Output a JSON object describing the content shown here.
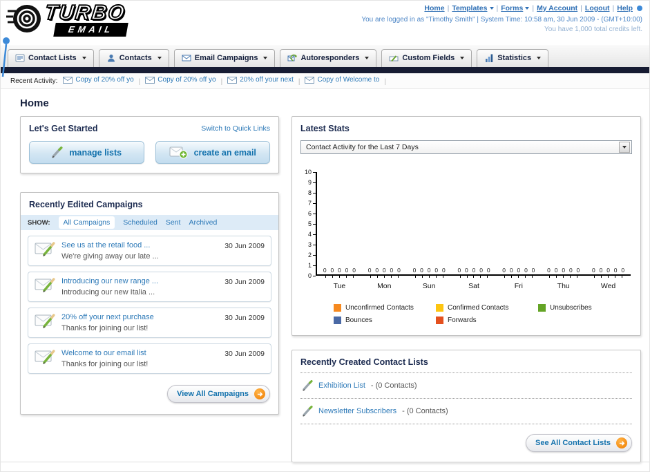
{
  "page": {
    "title": "Home"
  },
  "header": {
    "logo_primary": "TURBO",
    "logo_secondary": "EMAIL",
    "nav": [
      {
        "label": "Home",
        "dropdown": false
      },
      {
        "label": "Templates",
        "dropdown": true
      },
      {
        "label": "Forms",
        "dropdown": true
      },
      {
        "label": "My Account",
        "dropdown": false
      },
      {
        "label": "Logout",
        "dropdown": false
      },
      {
        "label": "Help",
        "dropdown": false
      }
    ],
    "login_info": "You are logged in as \"Timothy Smith\" | System Time: 10:58 am, 30 Jun 2009 - (GMT+10:00)",
    "credits_info": "You have 1,000 total credits left."
  },
  "main_tabs": [
    {
      "label": "Contact Lists",
      "icon": "contact-lists"
    },
    {
      "label": "Contacts",
      "icon": "contacts"
    },
    {
      "label": "Email Campaigns",
      "icon": "email-campaigns"
    },
    {
      "label": "Autoresponders",
      "icon": "autoresponders"
    },
    {
      "label": "Custom Fields",
      "icon": "custom-fields"
    },
    {
      "label": "Statistics",
      "icon": "statistics"
    }
  ],
  "recent_activity": {
    "label": "Recent Activity:",
    "items": [
      "Copy of 20% off yo",
      "Copy of 20% off yo",
      "20% off your next",
      "Copy of Welcome to"
    ]
  },
  "get_started": {
    "title": "Let's Get Started",
    "switch_link": "Switch to Quick Links",
    "manage_lists_label": "manage lists",
    "create_email_label": "create an email"
  },
  "campaigns": {
    "title": "Recently Edited Campaigns",
    "show_label": "SHOW:",
    "filters": [
      "All Campaigns",
      "Scheduled",
      "Sent",
      "Archived"
    ],
    "active_filter": 0,
    "items": [
      {
        "title": "See us at the retail food ...",
        "subtitle": "We're giving away our late ...",
        "date": "30 Jun 2009"
      },
      {
        "title": "Introducing our new range ...",
        "subtitle": "Introducing our new Italia ...",
        "date": "30 Jun 2009"
      },
      {
        "title": "20% off your next purchase",
        "subtitle": "Thanks for joining our list!",
        "date": "30 Jun 2009"
      },
      {
        "title": "Welcome to our email list",
        "subtitle": "Thanks for joining our list!",
        "date": "30 Jun 2009"
      }
    ],
    "view_all_label": "View All Campaigns"
  },
  "stats": {
    "title": "Latest Stats",
    "period_value": "Contact Activity for the Last 7 Days",
    "chart_data": {
      "type": "bar",
      "title": "Contact Activity for the Last 7 Days",
      "categories": [
        "Tue",
        "Mon",
        "Sun",
        "Sat",
        "Fri",
        "Thu",
        "Wed"
      ],
      "series": [
        {
          "name": "Unconfirmed Contacts",
          "color": "#f6891f",
          "values": [
            0,
            0,
            0,
            0,
            0,
            0,
            0
          ]
        },
        {
          "name": "Confirmed Contacts",
          "color": "#fdc511",
          "values": [
            0,
            0,
            0,
            0,
            0,
            0,
            0
          ]
        },
        {
          "name": "Unsubscribes",
          "color": "#64a426",
          "values": [
            0,
            0,
            0,
            0,
            0,
            0,
            0
          ]
        },
        {
          "name": "Bounces",
          "color": "#4a69a5",
          "values": [
            0,
            0,
            0,
            0,
            0,
            0,
            0
          ]
        },
        {
          "name": "Forwards",
          "color": "#e4501e",
          "values": [
            0,
            0,
            0,
            0,
            0,
            0,
            0
          ]
        }
      ],
      "ylim": [
        0,
        10
      ],
      "yticks": [
        0,
        1,
        2,
        3,
        4,
        5,
        6,
        7,
        8,
        9,
        10
      ],
      "grid": false,
      "legend_position": "bottom",
      "value_labels_shown": true
    }
  },
  "contact_lists": {
    "title": "Recently Created Contact Lists",
    "items": [
      {
        "name": "Exhibition List",
        "count": "(0 Contacts)"
      },
      {
        "name": "Newsletter Subscribers",
        "count": "(0 Contacts)"
      }
    ],
    "see_all_label": "See All Contact Lists"
  }
}
